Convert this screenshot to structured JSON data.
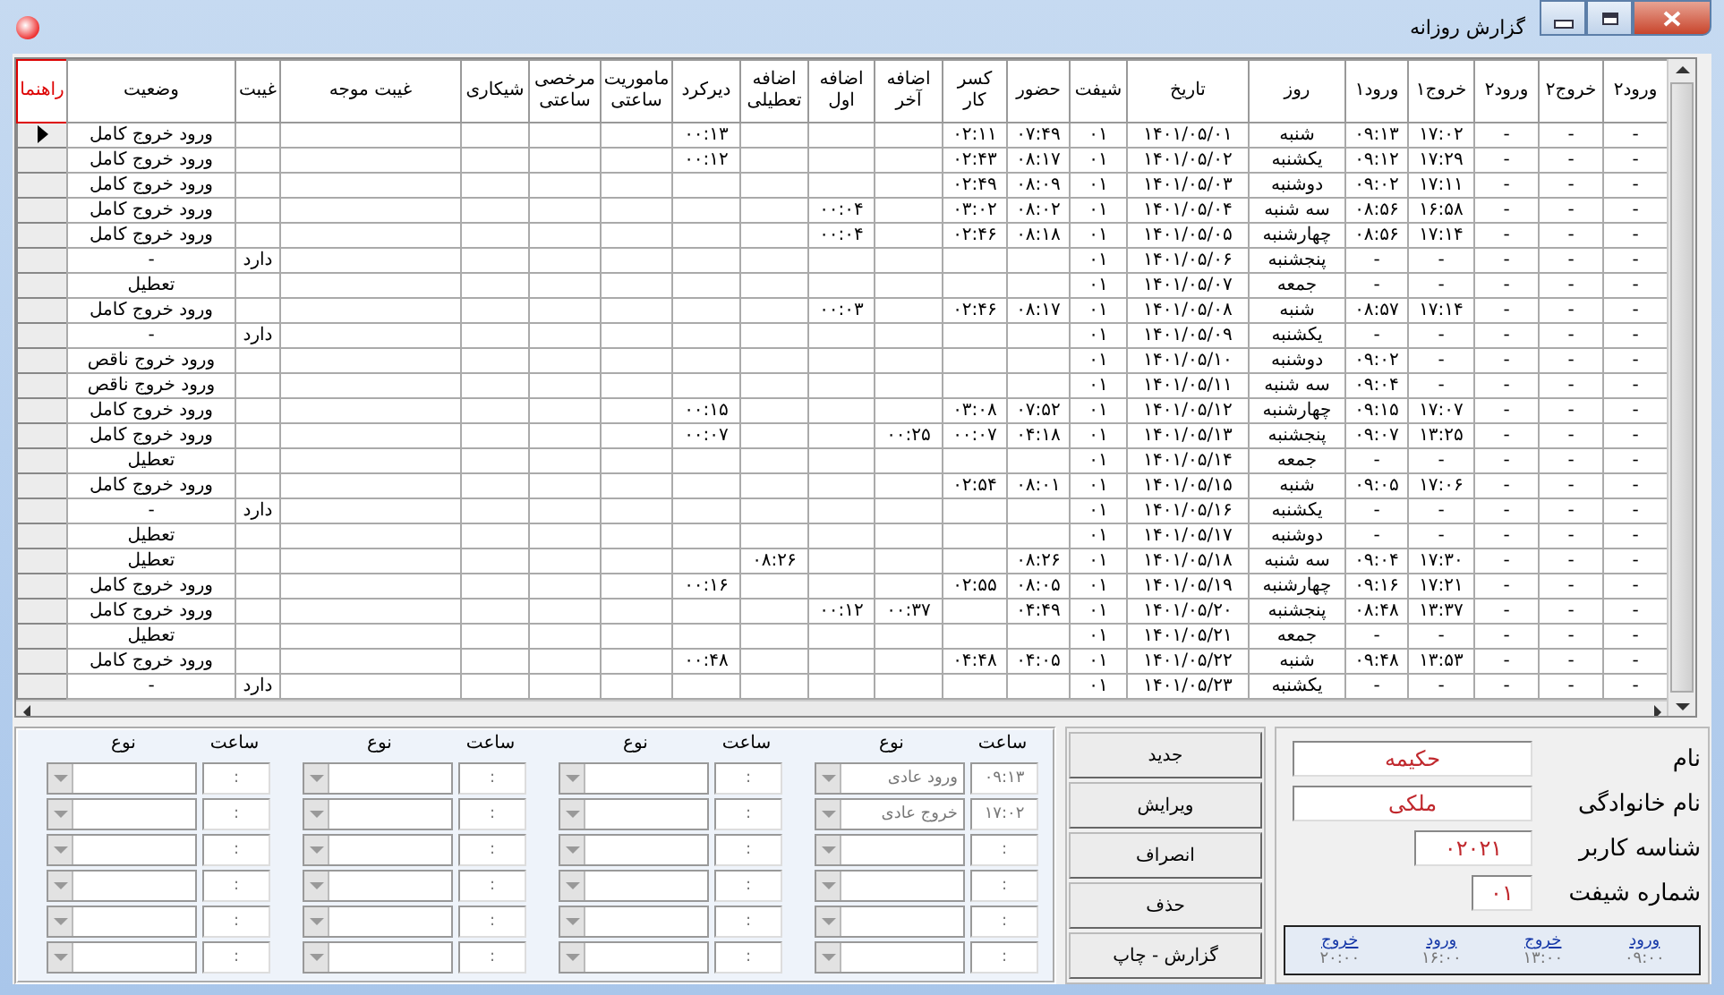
{
  "window": {
    "title": "گزارش روزانه"
  },
  "grid": {
    "columns": [
      "ورود۲",
      "خروج۲",
      "ورود۲",
      "خروج۱",
      "ورود۱",
      "روز",
      "تاریخ",
      "شیفت",
      "حضور",
      "کسر کار",
      "اضافه آخر",
      "اضافه اول",
      "اضافه تعطیلی",
      "دیرکرد",
      "ماموریت ساعتی",
      "مرخصی ساعتی",
      "شیکاری",
      "غیبت موجه",
      "غیبت",
      "وضعیت",
      "راهنما"
    ],
    "rows": [
      {
        "selected": true,
        "cells": [
          "-",
          "-",
          "-",
          "۱۷:۰۲",
          "۰۹:۱۳",
          "شنبه",
          "۱۴۰۱/۰۵/۰۱",
          "۰۱",
          "۰۷:۴۹",
          "۰۲:۱۱",
          null,
          null,
          null,
          "۰۰:۱۳",
          null,
          null,
          null,
          null,
          null,
          "ورود خروج کامل"
        ]
      },
      {
        "selected": false,
        "cells": [
          "-",
          "-",
          "-",
          "۱۷:۲۹",
          "۰۹:۱۲",
          "یکشنبه",
          "۱۴۰۱/۰۵/۰۲",
          "۰۱",
          "۰۸:۱۷",
          "۰۲:۴۳",
          null,
          null,
          null,
          "۰۰:۱۲",
          null,
          null,
          null,
          null,
          null,
          "ورود خروج کامل"
        ]
      },
      {
        "selected": false,
        "cells": [
          "-",
          "-",
          "-",
          "۱۷:۱۱",
          "۰۹:۰۲",
          "دوشنبه",
          "۱۴۰۱/۰۵/۰۳",
          "۰۱",
          "۰۸:۰۹",
          "۰۲:۴۹",
          null,
          null,
          null,
          null,
          null,
          null,
          null,
          null,
          null,
          "ورود خروج کامل"
        ]
      },
      {
        "selected": false,
        "cells": [
          "-",
          "-",
          "-",
          "۱۶:۵۸",
          "۰۸:۵۶",
          "سه شنبه",
          "۱۴۰۱/۰۵/۰۴",
          "۰۱",
          "۰۸:۰۲",
          "۰۳:۰۲",
          null,
          "۰۰:۰۴",
          null,
          null,
          null,
          null,
          null,
          null,
          null,
          "ورود خروج کامل"
        ]
      },
      {
        "selected": false,
        "cells": [
          "-",
          "-",
          "-",
          "۱۷:۱۴",
          "۰۸:۵۶",
          "چهارشنبه",
          "۱۴۰۱/۰۵/۰۵",
          "۰۱",
          "۰۸:۱۸",
          "۰۲:۴۶",
          null,
          "۰۰:۰۴",
          null,
          null,
          null,
          null,
          null,
          null,
          null,
          "ورود خروج کامل"
        ]
      },
      {
        "selected": false,
        "cells": [
          "-",
          "-",
          "-",
          "-",
          "-",
          "پنجشنبه",
          "۱۴۰۱/۰۵/۰۶",
          "۰۱",
          null,
          null,
          null,
          null,
          null,
          null,
          null,
          null,
          null,
          null,
          "دارد",
          "-"
        ]
      },
      {
        "selected": false,
        "cells": [
          "-",
          "-",
          "-",
          "-",
          "-",
          "جمعه",
          "۱۴۰۱/۰۵/۰۷",
          "۰۱",
          null,
          null,
          null,
          null,
          null,
          null,
          null,
          null,
          null,
          null,
          null,
          "تعطیل"
        ]
      },
      {
        "selected": false,
        "cells": [
          "-",
          "-",
          "-",
          "۱۷:۱۴",
          "۰۸:۵۷",
          "شنبه",
          "۱۴۰۱/۰۵/۰۸",
          "۰۱",
          "۰۸:۱۷",
          "۰۲:۴۶",
          null,
          "۰۰:۰۳",
          null,
          null,
          null,
          null,
          null,
          null,
          null,
          "ورود خروج کامل"
        ]
      },
      {
        "selected": false,
        "cells": [
          "-",
          "-",
          "-",
          "-",
          "-",
          "یکشنبه",
          "۱۴۰۱/۰۵/۰۹",
          "۰۱",
          null,
          null,
          null,
          null,
          null,
          null,
          null,
          null,
          null,
          null,
          "دارد",
          "-"
        ]
      },
      {
        "selected": false,
        "cells": [
          "-",
          "-",
          "-",
          "-",
          "۰۹:۰۲",
          "دوشنبه",
          "۱۴۰۱/۰۵/۱۰",
          "۰۱",
          null,
          null,
          null,
          null,
          null,
          null,
          null,
          null,
          null,
          null,
          null,
          "ورود خروج ناقص"
        ]
      },
      {
        "selected": false,
        "cells": [
          "-",
          "-",
          "-",
          "-",
          "۰۹:۰۴",
          "سه شنبه",
          "۱۴۰۱/۰۵/۱۱",
          "۰۱",
          null,
          null,
          null,
          null,
          null,
          null,
          null,
          null,
          null,
          null,
          null,
          "ورود خروج ناقص"
        ]
      },
      {
        "selected": false,
        "cells": [
          "-",
          "-",
          "-",
          "۱۷:۰۷",
          "۰۹:۱۵",
          "چهارشنبه",
          "۱۴۰۱/۰۵/۱۲",
          "۰۱",
          "۰۷:۵۲",
          "۰۳:۰۸",
          null,
          null,
          null,
          "۰۰:۱۵",
          null,
          null,
          null,
          null,
          null,
          "ورود خروج کامل"
        ]
      },
      {
        "selected": false,
        "cells": [
          "-",
          "-",
          "-",
          "۱۳:۲۵",
          "۰۹:۰۷",
          "پنجشنبه",
          "۱۴۰۱/۰۵/۱۳",
          "۰۱",
          "۰۴:۱۸",
          "۰۰:۰۷",
          "۰۰:۲۵",
          null,
          null,
          "۰۰:۰۷",
          null,
          null,
          null,
          null,
          null,
          "ورود خروج کامل"
        ]
      },
      {
        "selected": false,
        "cells": [
          "-",
          "-",
          "-",
          "-",
          "-",
          "جمعه",
          "۱۴۰۱/۰۵/۱۴",
          "۰۱",
          null,
          null,
          null,
          null,
          null,
          null,
          null,
          null,
          null,
          null,
          null,
          "تعطیل"
        ]
      },
      {
        "selected": false,
        "cells": [
          "-",
          "-",
          "-",
          "۱۷:۰۶",
          "۰۹:۰۵",
          "شنبه",
          "۱۴۰۱/۰۵/۱۵",
          "۰۱",
          "۰۸:۰۱",
          "۰۲:۵۴",
          null,
          null,
          null,
          null,
          null,
          null,
          null,
          null,
          null,
          "ورود خروج کامل"
        ]
      },
      {
        "selected": false,
        "cells": [
          "-",
          "-",
          "-",
          "-",
          "-",
          "یکشنبه",
          "۱۴۰۱/۰۵/۱۶",
          "۰۱",
          null,
          null,
          null,
          null,
          null,
          null,
          null,
          null,
          null,
          null,
          "دارد",
          "-"
        ]
      },
      {
        "selected": false,
        "cells": [
          "-",
          "-",
          "-",
          "-",
          "-",
          "دوشنبه",
          "۱۴۰۱/۰۵/۱۷",
          "۰۱",
          null,
          null,
          null,
          null,
          null,
          null,
          null,
          null,
          null,
          null,
          null,
          "تعطیل"
        ]
      },
      {
        "selected": false,
        "cells": [
          "-",
          "-",
          "-",
          "۱۷:۳۰",
          "۰۹:۰۴",
          "سه شنبه",
          "۱۴۰۱/۰۵/۱۸",
          "۰۱",
          "۰۸:۲۶",
          null,
          null,
          null,
          "۰۸:۲۶",
          null,
          null,
          null,
          null,
          null,
          null,
          "تعطیل"
        ]
      },
      {
        "selected": false,
        "cells": [
          "-",
          "-",
          "-",
          "۱۷:۲۱",
          "۰۹:۱۶",
          "چهارشنبه",
          "۱۴۰۱/۰۵/۱۹",
          "۰۱",
          "۰۸:۰۵",
          "۰۲:۵۵",
          null,
          null,
          null,
          "۰۰:۱۶",
          null,
          null,
          null,
          null,
          null,
          "ورود خروج کامل"
        ]
      },
      {
        "selected": false,
        "cells": [
          "-",
          "-",
          "-",
          "۱۳:۳۷",
          "۰۸:۴۸",
          "پنجشنبه",
          "۱۴۰۱/۰۵/۲۰",
          "۰۱",
          "۰۴:۴۹",
          null,
          "۰۰:۳۷",
          "۰۰:۱۲",
          null,
          null,
          null,
          null,
          null,
          null,
          null,
          "ورود خروج کامل"
        ]
      },
      {
        "selected": false,
        "cells": [
          "-",
          "-",
          "-",
          "-",
          "-",
          "جمعه",
          "۱۴۰۱/۰۵/۲۱",
          "۰۱",
          null,
          null,
          null,
          null,
          null,
          null,
          null,
          null,
          null,
          null,
          null,
          "تعطیل"
        ]
      },
      {
        "selected": false,
        "cells": [
          "-",
          "-",
          "-",
          "۱۳:۵۳",
          "۰۹:۴۸",
          "شنبه",
          "۱۴۰۱/۰۵/۲۲",
          "۰۱",
          "۰۴:۰۵",
          "۰۴:۴۸",
          null,
          null,
          null,
          "۰۰:۴۸",
          null,
          null,
          null,
          null,
          null,
          "ورود خروج کامل"
        ]
      },
      {
        "selected": false,
        "cells": [
          "-",
          "-",
          "-",
          "-",
          "-",
          "یکشنبه",
          "۱۴۰۱/۰۵/۲۳",
          "۰۱",
          null,
          null,
          null,
          null,
          null,
          null,
          null,
          null,
          null,
          null,
          "دارد",
          "-"
        ]
      }
    ]
  },
  "punches": {
    "groups": [
      {
        "time_label": "ساعت",
        "type_label": "نوع",
        "entries": [
          {
            "time": "۰۹:۱۳",
            "type": "ورود عادی"
          },
          {
            "time": "۱۷:۰۲",
            "type": "خروج عادی"
          },
          {
            "time": ":"
          },
          {
            "time": ":"
          },
          {
            "time": ":"
          },
          {
            "time": ":"
          }
        ]
      },
      {
        "time_label": "ساعت",
        "type_label": "نوع",
        "entries": [
          {
            "time": ":"
          },
          {
            "time": ":"
          },
          {
            "time": ":"
          },
          {
            "time": ":"
          },
          {
            "time": ":"
          },
          {
            "time": ":"
          }
        ]
      },
      {
        "time_label": "ساعت",
        "type_label": "نوع",
        "entries": [
          {
            "time": ":"
          },
          {
            "time": ":"
          },
          {
            "time": ":"
          },
          {
            "time": ":"
          },
          {
            "time": ":"
          },
          {
            "time": ":"
          }
        ]
      },
      {
        "time_label": "ساعت",
        "type_label": "نوع",
        "entries": [
          {
            "time": ":"
          },
          {
            "time": ":"
          },
          {
            "time": ":"
          },
          {
            "time": ":"
          },
          {
            "time": ":"
          },
          {
            "time": ":"
          }
        ]
      }
    ]
  },
  "buttons": [
    "جدید",
    "ویرایش",
    "انصراف",
    "حذف",
    "گزارش - چاپ"
  ],
  "employee": {
    "fields": [
      {
        "label": "نام",
        "value": "حکیمه"
      },
      {
        "label": "نام خانوادگی",
        "value": "ملکی"
      },
      {
        "label": "شناسه کاربر",
        "value": "۰۲۰۲۱"
      },
      {
        "label": "شماره شیفت",
        "value": "۰۱"
      }
    ],
    "shift_times": [
      {
        "label": "ورود",
        "time": "۰۹:۰۰"
      },
      {
        "label": "خروج",
        "time": "۱۳:۰۰"
      },
      {
        "label": "ورود",
        "time": "۱۶:۰۰"
      },
      {
        "label": "خروج",
        "time": "۲۰:۰۰"
      }
    ]
  }
}
